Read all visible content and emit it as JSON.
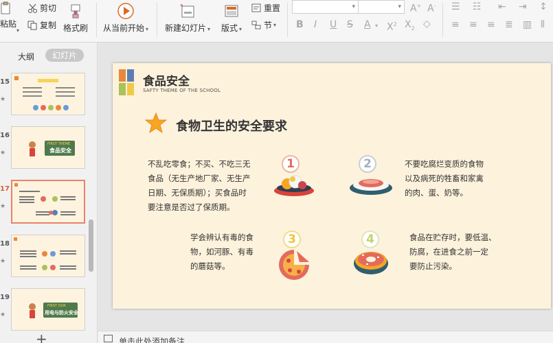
{
  "ribbon": {
    "paste_label": "粘贴",
    "cut_label": "剪切",
    "copy_label": "复制",
    "format_painter_label": "格式刷",
    "from_current_label": "从当前开始",
    "new_slide_label": "新建幻灯片",
    "layout_label": "版式",
    "reset_label": "重置",
    "section_label": "节"
  },
  "panel": {
    "tab_outline": "大纲",
    "tab_slides": "幻灯片",
    "slides": [
      {
        "num": "15",
        "active": false
      },
      {
        "num": "16",
        "active": false
      },
      {
        "num": "17",
        "active": true
      },
      {
        "num": "18",
        "active": false
      },
      {
        "num": "19",
        "active": false
      }
    ],
    "thumb16_title": "FIRST THEME",
    "thumb16_sub": "食品安全",
    "thumb19_title": "FIRST OUR",
    "thumb19_sub": "用电与防火安全",
    "add_label": "+"
  },
  "slide": {
    "header_title": "食品安全",
    "header_sub": "SAFTY THEME OF THE SCHOOL",
    "heading": "食物卫生的安全要求",
    "items": [
      {
        "num": "1",
        "text": [
          "不乱吃零食；不买、不吃三无",
          "食品（无生产地厂家、无生产",
          "日期、无保质期）；买食品时",
          "要注意是否过了保质期。"
        ]
      },
      {
        "num": "2",
        "text": [
          "不要吃腐烂变质的食物",
          "以及病死的牲畜和家禽",
          "的肉、蛋、奶等。"
        ]
      },
      {
        "num": "3",
        "text": [
          "学会辨认有毒的食",
          "物，如河豚、有毒",
          "的蘑菇等。"
        ]
      },
      {
        "num": "4",
        "text": [
          "食品在贮存时，要低温、",
          "防腐，在进食之前一定",
          "要防止污染。"
        ]
      }
    ],
    "colors": {
      "bg": "#fdf2dc",
      "accent_orange": "#e9883d",
      "accent_red": "#d8443a",
      "accent_green": "#a9c25a",
      "accent_blue": "#5b7fb3"
    }
  },
  "notes": {
    "placeholder": "单击此处添加备注"
  }
}
